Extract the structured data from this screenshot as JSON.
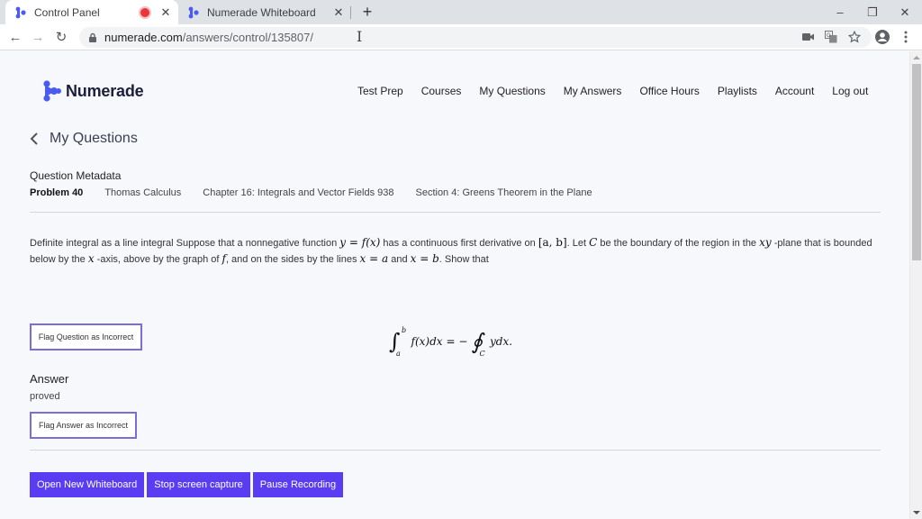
{
  "browser": {
    "tabs": [
      {
        "title": "Control Panel",
        "icon": "numerade-favicon",
        "recording": true,
        "active": true
      },
      {
        "title": "Numerade Whiteboard",
        "icon": "numerade-favicon",
        "recording": false,
        "active": false
      }
    ],
    "tab_close_glyph": "✕",
    "new_tab_glyph": "+",
    "window_controls": {
      "minimize": "–",
      "restore": "❐",
      "close": "✕"
    },
    "nav": {
      "back": "←",
      "forward": "→",
      "reload": "↻"
    },
    "url": {
      "host": "numerade.com",
      "path": "/answers/control/135807/"
    },
    "text_cursor_glyph": "I",
    "toolbar_icons": [
      "camera-icon",
      "translate-icon",
      "star-icon",
      "profile-icon",
      "menu-icon"
    ]
  },
  "site": {
    "brand": "Numerade",
    "brand_color": "#4a5cf0",
    "nav": [
      "Test Prep",
      "Courses",
      "My Questions",
      "My Answers",
      "Office Hours",
      "Playlists",
      "Account",
      "Log out"
    ]
  },
  "page": {
    "back_label": "My Questions",
    "metadata": {
      "title": "Question Metadata",
      "problem": "Problem 40",
      "book": "Thomas Calculus",
      "chapter": "Chapter 16: Integrals and Vector Fields 938",
      "section": "Section 4: Greens Theorem in the Plane"
    },
    "question": {
      "t1": "Definite integral as a line integral Suppose that a nonnegative function ",
      "m1": "y = f(x)",
      "t2": " has a continuous first derivative on ",
      "m2": "[a, b]",
      "t3": ". Let ",
      "m3": "C",
      "t4": " be the boundary of the region in the ",
      "m4": "xy",
      "t5": " -plane that is bounded below by the ",
      "m5": "x",
      "t6": " -axis, above by the graph of ",
      "m6": "f",
      "t7": ", and on the sides by the lines ",
      "m7": "x = a",
      "t8": " and ",
      "m8": "x = b",
      "t9": ". Show that",
      "equation": {
        "int_upper": "b",
        "int_lower": "a",
        "integrand": "f(x)dx",
        "equals": "= −",
        "contour_sub": "C",
        "rhs": "ydx."
      }
    },
    "flag_question_label": "Flag Question as Incorrect",
    "answer_title": "Answer",
    "answer_value": "proved",
    "flag_answer_label": "Flag Answer as Incorrect",
    "actions": [
      "Open New Whiteboard",
      "Stop screen capture",
      "Pause Recording"
    ],
    "accent_color": "#5a3cf2",
    "flag_border_color": "#7b6cd8"
  }
}
